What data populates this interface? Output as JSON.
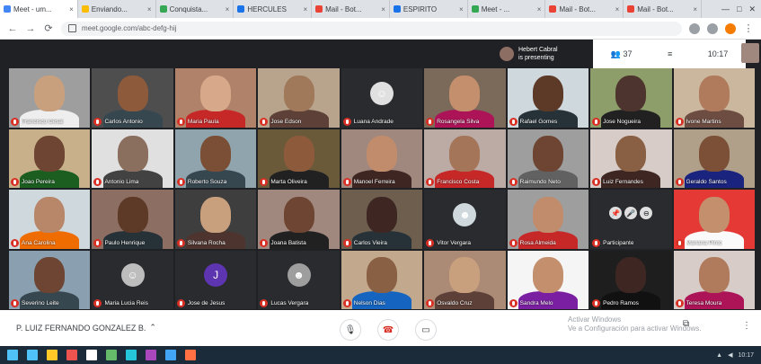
{
  "browser": {
    "tabs": [
      {
        "label": "Meet - um..."
      },
      {
        "label": "Enviando..."
      },
      {
        "label": "Conquista..."
      },
      {
        "label": "HERCULES"
      },
      {
        "label": "Mail - Bot..."
      },
      {
        "label": "ESPIRITO"
      },
      {
        "label": "Meet - ..."
      },
      {
        "label": "Mail - Bot..."
      },
      {
        "label": "Mail - Bot..."
      }
    ],
    "url": "meet.google.com/abc-defg-hij",
    "window_controls": [
      "—",
      "□",
      "✕"
    ]
  },
  "meet": {
    "presenter": {
      "line1": "Hebert Cabral",
      "line2": "is presenting"
    },
    "top_controls": {
      "people_count": "37",
      "chat": "≡",
      "time": "10:17"
    },
    "participants": [
      {
        "name": "Francisco Cesar",
        "mode": "video",
        "skin": "#c9a07e",
        "bg": "#9e9e9e",
        "shirt": "#eeeeee"
      },
      {
        "name": "Carlos Antonio",
        "mode": "video",
        "skin": "#8d5a3b",
        "bg": "#4e4e4e",
        "shirt": "#37474f"
      },
      {
        "name": "Maria Paula",
        "mode": "video",
        "skin": "#d7a98a",
        "bg": "#b0826a",
        "shirt": "#c62828"
      },
      {
        "name": "Jose Edson",
        "mode": "video",
        "skin": "#a0785a",
        "bg": "#b8a48c",
        "shirt": "#5d4037"
      },
      {
        "name": "Luana Andrade",
        "mode": "avatar",
        "avatar_color": "#e0e0e0",
        "letter": "☺"
      },
      {
        "name": "Rosangela Silva",
        "mode": "video",
        "skin": "#c48f6d",
        "bg": "#7b6a5a",
        "shirt": "#ad1457"
      },
      {
        "name": "Rafael Gomes",
        "mode": "video",
        "skin": "#5d3a27",
        "bg": "#cfd8dc",
        "shirt": "#263238"
      },
      {
        "name": "Jose Nogueira",
        "mode": "video",
        "skin": "#4e342e",
        "bg": "#8d9e6a",
        "shirt": "#212121"
      },
      {
        "name": "Ivone Martins",
        "mode": "video",
        "skin": "#b07a5c",
        "bg": "#cbb79e",
        "shirt": "#6d4c41"
      },
      {
        "name": "Joao Pereira",
        "mode": "video",
        "skin": "#6d4532",
        "bg": "#c7b08a",
        "shirt": "#1b5e20"
      },
      {
        "name": "Antonio Lima",
        "mode": "video",
        "skin": "#8a6e5e",
        "bg": "#e0e0e0",
        "shirt": "#424242"
      },
      {
        "name": "Roberto Souza",
        "mode": "video",
        "skin": "#7a4f36",
        "bg": "#90a4ae",
        "shirt": "#37474f"
      },
      {
        "name": "Marta Oliveira",
        "mode": "video",
        "skin": "#8d5a3b",
        "bg": "#6b5a3a",
        "shirt": "#212121"
      },
      {
        "name": "Manoel Ferreira",
        "mode": "video",
        "skin": "#c08c6c",
        "bg": "#a1887f",
        "shirt": "#3e2723"
      },
      {
        "name": "Francisco Costa",
        "mode": "video",
        "skin": "#a5755a",
        "bg": "#bcaaa4",
        "shirt": "#c62828"
      },
      {
        "name": "Raimundo Neto",
        "mode": "video",
        "skin": "#6d4532",
        "bg": "#9e9e9e",
        "shirt": "#616161"
      },
      {
        "name": "Luiz Fernandes",
        "mode": "video",
        "skin": "#8a6045",
        "bg": "#d7ccc8",
        "shirt": "#3e2723"
      },
      {
        "name": "Geraldo Santos",
        "mode": "video",
        "skin": "#7b5036",
        "bg": "#b0a08a",
        "shirt": "#1a237e"
      },
      {
        "name": "Ana Carolina",
        "mode": "video",
        "skin": "#b8876a",
        "bg": "#cfd8dc",
        "shirt": "#ef6c00"
      },
      {
        "name": "Paulo Henrique",
        "mode": "video",
        "skin": "#5d3a27",
        "bg": "#8d6e63",
        "shirt": "#263238"
      },
      {
        "name": "Silvana Rocha",
        "mode": "video",
        "skin": "#c9a07e",
        "bg": "#3e3e3e",
        "shirt": "#4e342e"
      },
      {
        "name": "Joana Batista",
        "mode": "video",
        "skin": "#6d4532",
        "bg": "#a1887f",
        "shirt": "#212121"
      },
      {
        "name": "Carlos Vieira",
        "mode": "video",
        "skin": "#3e2723",
        "bg": "#6d5e4e",
        "shirt": "#263238"
      },
      {
        "name": "Vitor Vergara",
        "mode": "avatar",
        "avatar_color": "#cfd8dc",
        "letter": "☻"
      },
      {
        "name": "Rosa Almeida",
        "mode": "video",
        "skin": "#c08c6c",
        "bg": "#9e9e9e",
        "shirt": "#c62828"
      },
      {
        "name": "Participante",
        "mode": "hover",
        "bg": "#2a2b2e"
      },
      {
        "name": "Mariana Pinto",
        "mode": "video",
        "skin": "#c48f6d",
        "bg": "#e53935",
        "shirt": "#fafafa"
      },
      {
        "name": "Severino Leite",
        "mode": "video",
        "skin": "#6d4532",
        "bg": "#8aa0b0",
        "shirt": "#37474f"
      },
      {
        "name": "Maria Lucia Reis",
        "mode": "avatar",
        "avatar_color": "#bdbdbd",
        "letter": "☺"
      },
      {
        "name": "Jose de Jesus",
        "mode": "avatar",
        "avatar_color": "#5e35b1",
        "letter": "J"
      },
      {
        "name": "Lucas Vergara",
        "mode": "avatar",
        "avatar_color": "#9e9e9e",
        "letter": "☻"
      },
      {
        "name": "Nelson Dias",
        "mode": "video",
        "skin": "#8a6045",
        "bg": "#c2a98e",
        "shirt": "#1565c0"
      },
      {
        "name": "Osvaldo Cruz",
        "mode": "video",
        "skin": "#c9a07e",
        "bg": "#ab8a76",
        "shirt": "#5d4037"
      },
      {
        "name": "Sandra Melo",
        "mode": "video",
        "skin": "#c48f6d",
        "bg": "#f5f5f5",
        "shirt": "#7b1fa2"
      },
      {
        "name": "Pedro Ramos",
        "mode": "video",
        "skin": "#3e2723",
        "bg": "#1e1e1e",
        "shirt": "#111111"
      },
      {
        "name": "Teresa Moura",
        "mode": "video",
        "skin": "#b07a5c",
        "bg": "#d7ccc8",
        "shirt": "#ad1457"
      }
    ],
    "bottom": {
      "meeting_name": "P. LUIZ FERNANDO GONZALEZ B.",
      "chevron": "⌃",
      "activate_windows_1": "Activar Windows",
      "activate_windows_2": "Ve a Configuración para activar Windows.",
      "captions_label": "Subtitular",
      "present_label": "Presentar ahora"
    }
  },
  "taskbar": {
    "apps": [
      "#4fc3f7",
      "#ffca28",
      "#ef5350",
      "#ffffff",
      "#66bb6a",
      "#26c6da",
      "#ab47bc",
      "#42a5f5",
      "#ff7043"
    ],
    "clock": "10:17",
    "date": "31/07/2020"
  }
}
